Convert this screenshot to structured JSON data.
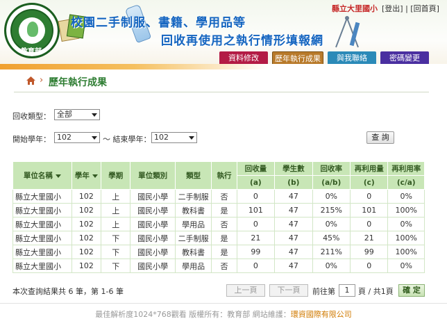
{
  "header": {
    "title_line1": "校園二手制服、書籍、學用品等",
    "title_line2": "回收再使用之執行情形填報網",
    "logo_text": "教育部",
    "school_name": "縣立大里國小",
    "links": [
      "[登出]",
      "[回首頁]"
    ],
    "nav": [
      "資料修改",
      "歷年執行成果",
      "與我聯絡",
      "密碼變更"
    ]
  },
  "breadcrumb": {
    "page_title": "歷年執行成果"
  },
  "filters": {
    "type_label": "回收類型：",
    "type_value": "全部",
    "start_label": "開始學年：",
    "start_value": "102",
    "range_sep": "～ 結束學年：",
    "end_value": "102",
    "query_button": "查 詢"
  },
  "table": {
    "headers": [
      "單位名稱",
      "學年",
      "學期",
      "單位類別",
      "類型",
      "執行",
      "回收量",
      "學生數",
      "回收率",
      "再利用量",
      "再利用率"
    ],
    "subheaders": [
      "(a)",
      "(b)",
      "(a/b)",
      "(c)",
      "(c/a)"
    ],
    "rows": [
      [
        "縣立大里國小",
        "102",
        "上",
        "國民小學",
        "二手制服",
        "否",
        "0",
        "47",
        "0%",
        "0",
        "0%"
      ],
      [
        "縣立大里國小",
        "102",
        "上",
        "國民小學",
        "教科書",
        "是",
        "101",
        "47",
        "215%",
        "101",
        "100%"
      ],
      [
        "縣立大里國小",
        "102",
        "上",
        "國民小學",
        "學用品",
        "否",
        "0",
        "47",
        "0%",
        "0",
        "0%"
      ],
      [
        "縣立大里國小",
        "102",
        "下",
        "國民小學",
        "二手制服",
        "是",
        "21",
        "47",
        "45%",
        "21",
        "100%"
      ],
      [
        "縣立大里國小",
        "102",
        "下",
        "國民小學",
        "教科書",
        "是",
        "99",
        "47",
        "211%",
        "99",
        "100%"
      ],
      [
        "縣立大里國小",
        "102",
        "下",
        "國民小學",
        "學用品",
        "否",
        "0",
        "47",
        "0%",
        "0",
        "0%"
      ]
    ]
  },
  "pager": {
    "summary": "本次查詢結果共 6 筆，第 1-6 筆",
    "prev": "上一頁",
    "next": "下一頁",
    "goto_prefix": "前往第",
    "page_value": "1",
    "goto_suffix": "頁 / 共1頁",
    "confirm": "確 定"
  },
  "footer": {
    "text": "最佳解析度1024*768觀看 版權所有：教育部 網站維護：",
    "org": "環資國際有限公司"
  },
  "colors": {
    "accent_green": "#c8e6b6",
    "title_blue": "#1565c0",
    "nav_red": "#b31b45"
  }
}
